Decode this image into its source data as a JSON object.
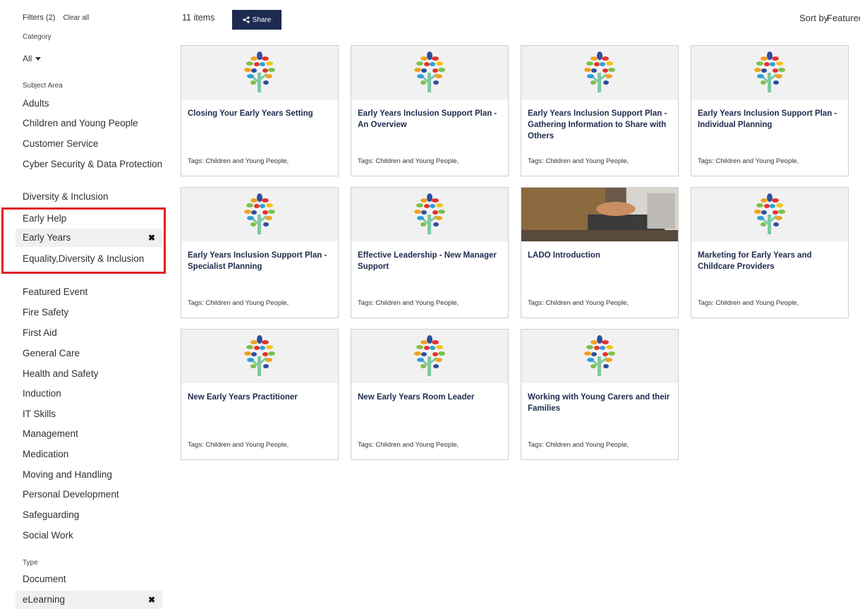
{
  "sidebar": {
    "filters_label": "Filters (2)",
    "clear_all": "Clear all",
    "category_label": "Category",
    "category_value": "All",
    "subject_label": "Subject Area",
    "subject_items": [
      "Adults",
      "Children and Young People",
      "Customer Service",
      "Cyber Security & Data Protection",
      "Diversity & Inclusion",
      "Early Help",
      "Early Years",
      "Equality,Diversity & Inclusion",
      "Featured Event",
      "Fire Safety",
      "First Aid",
      "General Care",
      "Health and Safety",
      "Induction",
      "IT Skills",
      "Management",
      "Medication",
      "Moving and Handling",
      "Personal Development",
      "Safeguarding",
      "Social Work"
    ],
    "type_label": "Type",
    "type_items": [
      "Document",
      "eLearning"
    ],
    "remove_glyph": "✖"
  },
  "header": {
    "item_count": "11 items",
    "share_label": "Share",
    "sort_label": "Sort by",
    "sort_value": "Featured"
  },
  "colors": {
    "accent": "#1e2a52",
    "highlight": "#e01f26",
    "title": "#1f2b4d"
  },
  "cards": [
    {
      "title": "Closing Your Early Years Setting",
      "tags": "Tags: Children and Young People,",
      "image": "tree-logo"
    },
    {
      "title": "Early Years Inclusion Support Plan - An Overview",
      "tags": "Tags: Children and Young People,",
      "image": "tree-logo"
    },
    {
      "title": "Early Years Inclusion Support Plan - Gathering Information to Share with Others",
      "tags": "Tags: Children and Young People,",
      "image": "tree-logo"
    },
    {
      "title": "Early Years Inclusion Support Plan - Individual Planning",
      "tags": "Tags: Children and Young People,",
      "image": "tree-logo"
    },
    {
      "title": "Early Years Inclusion Support Plan - Specialist Planning",
      "tags": "Tags: Children and Young People,",
      "image": "tree-logo"
    },
    {
      "title": "Effective Leadership - New Manager Support",
      "tags": "Tags: Children and Young People,",
      "image": "tree-logo"
    },
    {
      "title": "LADO Introduction",
      "tags": "Tags: Children and Young People,",
      "image": "laptop-photo"
    },
    {
      "title": "Marketing for Early Years and Childcare Providers",
      "tags": "Tags: Children and Young People,",
      "image": "tree-logo"
    },
    {
      "title": "New Early Years Practitioner",
      "tags": "Tags: Children and Young People,",
      "image": "tree-logo"
    },
    {
      "title": "New Early Years Room Leader",
      "tags": "Tags: Children and Young People,",
      "image": "tree-logo"
    },
    {
      "title": "Working with Young Carers and their Families",
      "tags": "Tags: Children and Young People,",
      "image": "tree-logo"
    }
  ]
}
